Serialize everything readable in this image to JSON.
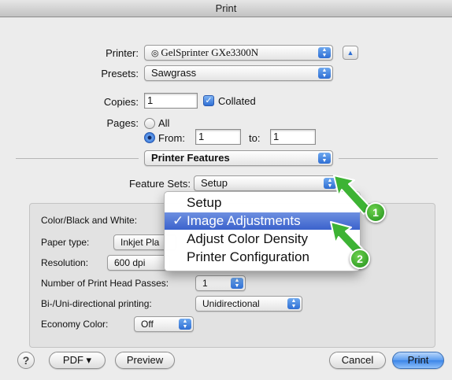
{
  "window": {
    "title": "Print"
  },
  "printer": {
    "label": "Printer:",
    "value": "GelSprinter GXe3300N"
  },
  "presets": {
    "label": "Presets:",
    "value": "Sawgrass"
  },
  "copies": {
    "label": "Copies:",
    "value": "1",
    "collated_label": "Collated"
  },
  "pages": {
    "label": "Pages:",
    "all_label": "All",
    "from_label": "From:",
    "from_value": "1",
    "to_label": "to:",
    "to_value": "1"
  },
  "section_popup": {
    "value": "Printer Features"
  },
  "feature_sets": {
    "label": "Feature Sets:",
    "value": "Setup",
    "menu": [
      {
        "label": "Setup",
        "checked": false
      },
      {
        "label": "Image Adjustments",
        "checked": true
      },
      {
        "label": "Adjust Color Density",
        "checked": false
      },
      {
        "label": "Printer Configuration",
        "checked": false
      }
    ],
    "check_glyph": "✓"
  },
  "settings": {
    "color_bw": {
      "label": "Color/Black and White:"
    },
    "paper_type": {
      "label": "Paper type:",
      "value": "Inkjet Pla"
    },
    "resolution": {
      "label": "Resolution:",
      "value": "600 dpi"
    },
    "print_head_passes": {
      "label": "Number of Print Head Passes:",
      "value": "1"
    },
    "bi_uni": {
      "label": "Bi-/Uni-directional printing:",
      "value": "Unidirectional"
    },
    "economy_color": {
      "label": "Economy Color:",
      "value": "Off"
    }
  },
  "callouts": {
    "one": "1",
    "two": "2"
  },
  "footer": {
    "help": "?",
    "pdf": "PDF ▾",
    "preview": "Preview",
    "cancel": "Cancel",
    "print": "Print"
  },
  "colors": {
    "accent": "#3b62cc",
    "callout_green": "#2fa52a"
  }
}
